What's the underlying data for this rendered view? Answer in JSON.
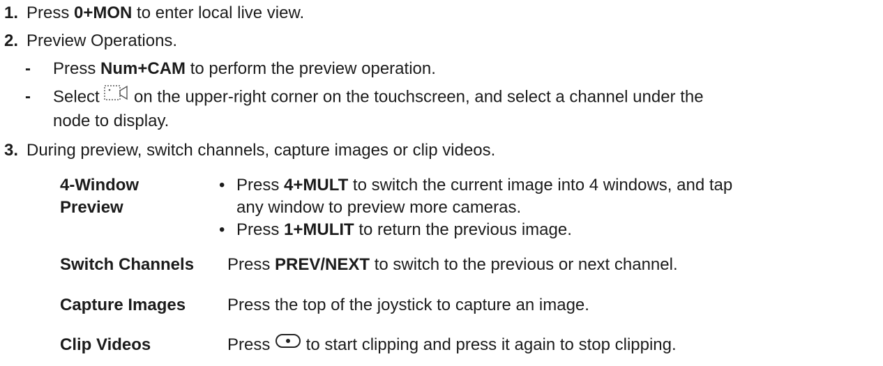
{
  "steps": [
    {
      "num": "1.",
      "pre": "Press ",
      "bold": "0+MON",
      "post": " to enter local live view."
    },
    {
      "num": "2.",
      "text": "Preview Operations."
    },
    {
      "num": "3.",
      "text": "During preview, switch channels, capture images or clip videos."
    }
  ],
  "substeps": {
    "dash": "-",
    "a": {
      "pre": "Press ",
      "bold": "Num+CAM",
      "post": " to perform the preview operation."
    },
    "b": {
      "pre": "Select ",
      "post": " on the upper-right corner on the touchscreen, and select a channel under the",
      "line2": "node to display.",
      "icon": "camera-icon"
    }
  },
  "table": {
    "rows": [
      {
        "label_line1": "4-Window",
        "label_line2": "Preview",
        "bullet": "•",
        "b1_pre": "Press ",
        "b1_bold": "4+MULT",
        "b1_post": " to switch the current image into 4 windows, and tap",
        "b1_line2": "any window to preview more cameras.",
        "b2_pre": "Press ",
        "b2_bold": "1+MULIT",
        "b2_post": " to return the previous image."
      },
      {
        "label": "Switch Channels",
        "pre": "Press ",
        "bold": "PREV/NEXT",
        "post": " to switch to the previous or next channel."
      },
      {
        "label": "Capture Images",
        "text": "Press the top of the joystick to capture an image."
      },
      {
        "label": "Clip Videos",
        "pre": "Press ",
        "post": " to start clipping and press it again to stop clipping.",
        "icon": "record-button-icon"
      }
    ]
  }
}
